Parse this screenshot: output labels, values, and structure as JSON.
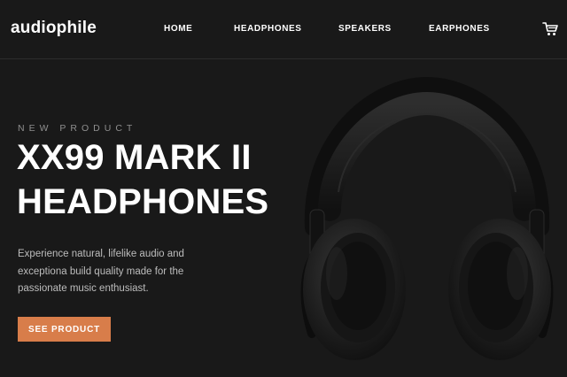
{
  "header": {
    "logo": "audiophile",
    "nav": [
      {
        "label": "HOME"
      },
      {
        "label": "HEADPHONES"
      },
      {
        "label": "SPEAKERS"
      },
      {
        "label": "EARPHONES"
      }
    ],
    "cart_icon": "cart-icon"
  },
  "hero": {
    "eyebrow": "NEW PRODUCT",
    "title_line1": "XX99 MARK II",
    "title_line2": "HEADPHONES",
    "description": "Experience natural, lifelike audio and exceptiona build quality made for the passionate music enthusiast.",
    "cta_label": "SEE PRODUCT",
    "image_icon": "headphones-image"
  },
  "colors": {
    "background": "#191919",
    "accent": "#d87d4a",
    "text": "#ffffff",
    "muted": "#8f8f8f"
  }
}
